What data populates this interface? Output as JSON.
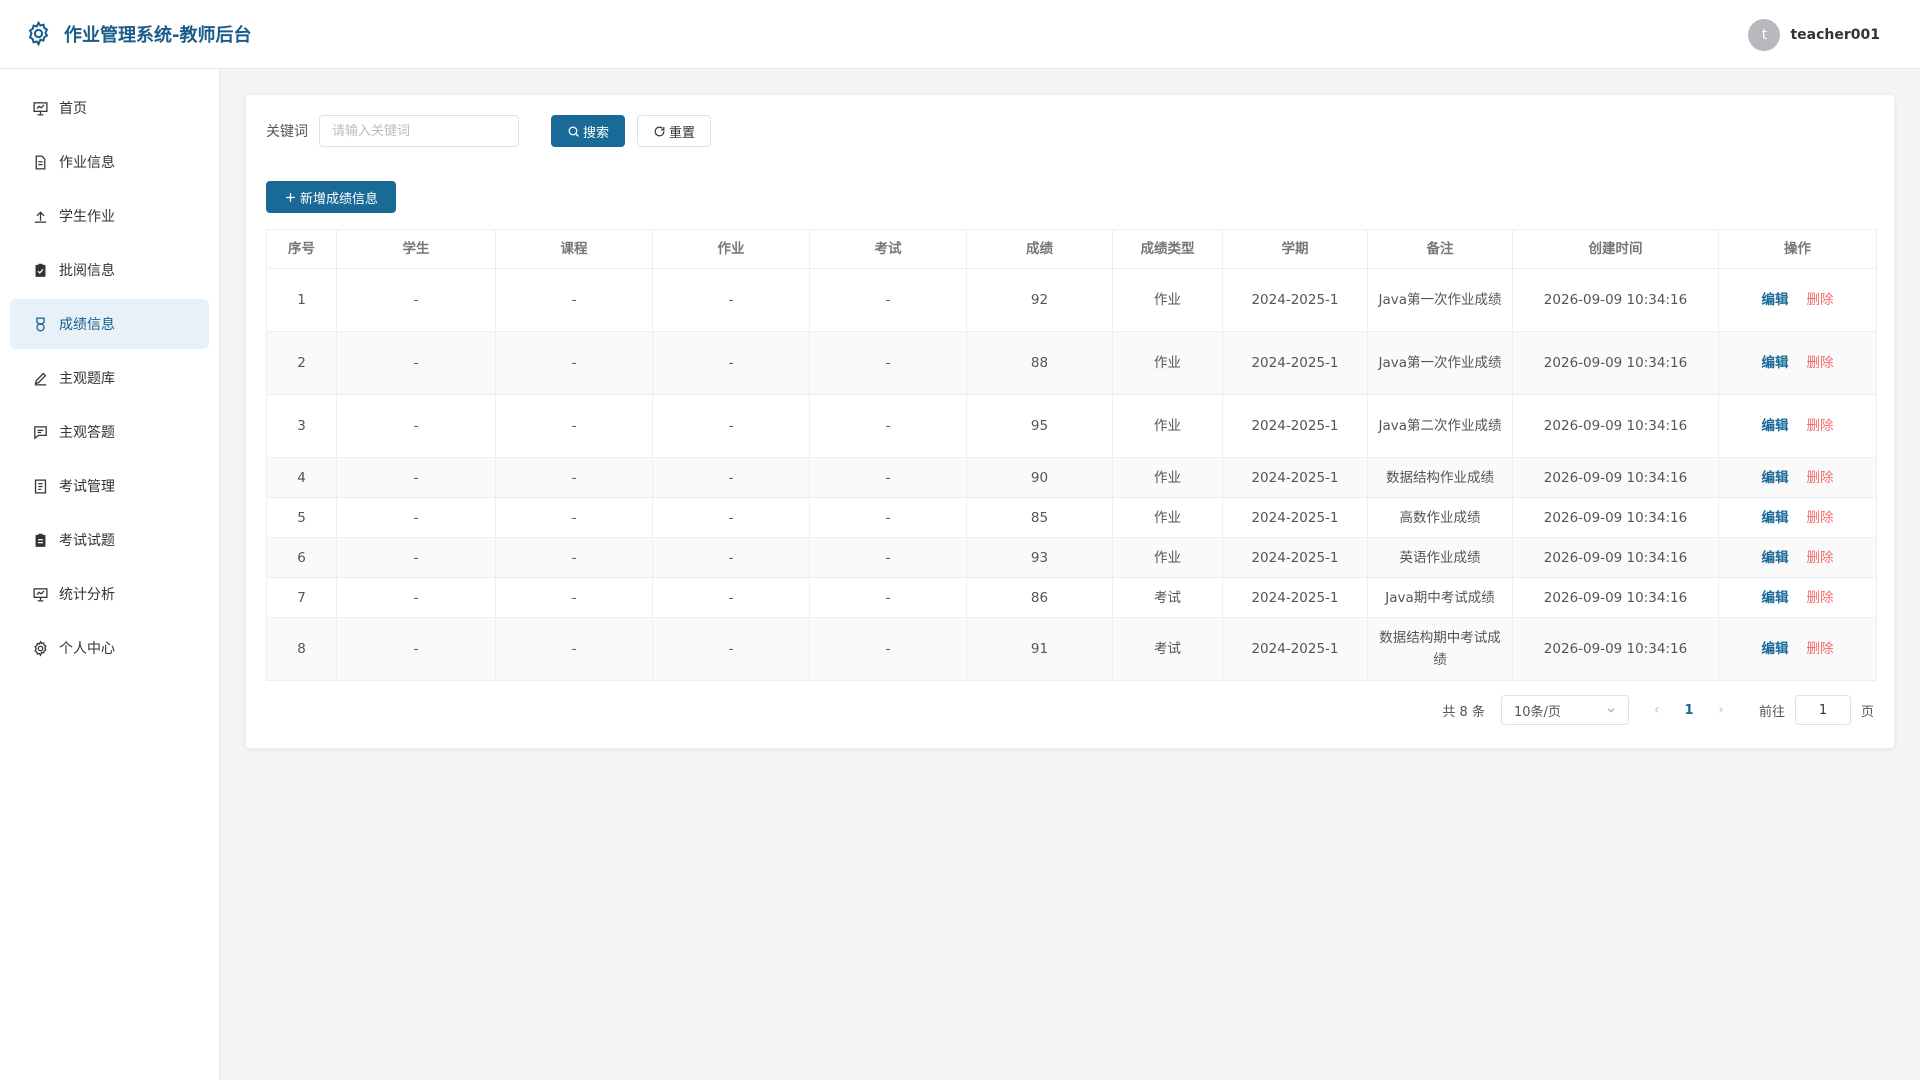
{
  "app": {
    "title": "作业管理系统-教师后台",
    "user": {
      "avatar_letter": "t",
      "name": "teacher001"
    },
    "accent_color": "#1a6a98"
  },
  "sidebar": {
    "items": [
      {
        "label": "首页",
        "icon": "dashboard-icon",
        "active": false
      },
      {
        "label": "作业信息",
        "icon": "document-icon",
        "active": false
      },
      {
        "label": "学生作业",
        "icon": "upload-icon",
        "active": false
      },
      {
        "label": "批阅信息",
        "icon": "clipboard-check-icon",
        "active": false
      },
      {
        "label": "成绩信息",
        "icon": "medal-icon",
        "active": true
      },
      {
        "label": "主观题库",
        "icon": "edit-pen-icon",
        "active": false
      },
      {
        "label": "主观答题",
        "icon": "chat-icon",
        "active": false
      },
      {
        "label": "考试管理",
        "icon": "tickets-icon",
        "active": false
      },
      {
        "label": "考试试题",
        "icon": "notebook-icon",
        "active": false
      },
      {
        "label": "统计分析",
        "icon": "chart-icon",
        "active": false
      },
      {
        "label": "个人中心",
        "icon": "settings-icon",
        "active": false
      }
    ]
  },
  "search": {
    "label": "关键词",
    "placeholder": "请输入关键词",
    "value": "",
    "search_button": "搜索",
    "reset_button": "重置"
  },
  "toolbar": {
    "add_button": "新增成绩信息"
  },
  "table": {
    "headers": [
      "序号",
      "学生",
      "课程",
      "作业",
      "考试",
      "成绩",
      "成绩类型",
      "学期",
      "备注",
      "创建时间",
      "操作"
    ],
    "edit_label": "编辑",
    "delete_label": "删除",
    "rows": [
      {
        "index": "1",
        "student": "-",
        "course": "-",
        "homework": "-",
        "exam": "-",
        "score": "92",
        "type": "作业",
        "term": "2024-2025-1",
        "note": "Java第一次作业成绩",
        "created": "2026-09-09 10:34:16"
      },
      {
        "index": "2",
        "student": "-",
        "course": "-",
        "homework": "-",
        "exam": "-",
        "score": "88",
        "type": "作业",
        "term": "2024-2025-1",
        "note": "Java第一次作业成绩",
        "created": "2026-09-09 10:34:16"
      },
      {
        "index": "3",
        "student": "-",
        "course": "-",
        "homework": "-",
        "exam": "-",
        "score": "95",
        "type": "作业",
        "term": "2024-2025-1",
        "note": "Java第二次作业成绩",
        "created": "2026-09-09 10:34:16"
      },
      {
        "index": "4",
        "student": "-",
        "course": "-",
        "homework": "-",
        "exam": "-",
        "score": "90",
        "type": "作业",
        "term": "2024-2025-1",
        "note": "数据结构作业成绩",
        "created": "2026-09-09 10:34:16"
      },
      {
        "index": "5",
        "student": "-",
        "course": "-",
        "homework": "-",
        "exam": "-",
        "score": "85",
        "type": "作业",
        "term": "2024-2025-1",
        "note": "高数作业成绩",
        "created": "2026-09-09 10:34:16"
      },
      {
        "index": "6",
        "student": "-",
        "course": "-",
        "homework": "-",
        "exam": "-",
        "score": "93",
        "type": "作业",
        "term": "2024-2025-1",
        "note": "英语作业成绩",
        "created": "2026-09-09 10:34:16"
      },
      {
        "index": "7",
        "student": "-",
        "course": "-",
        "homework": "-",
        "exam": "-",
        "score": "86",
        "type": "考试",
        "term": "2024-2025-1",
        "note": "Java期中考试成绩",
        "created": "2026-09-09 10:34:16"
      },
      {
        "index": "8",
        "student": "-",
        "course": "-",
        "homework": "-",
        "exam": "-",
        "score": "91",
        "type": "考试",
        "term": "2024-2025-1",
        "note": "数据结构期中考试成绩",
        "created": "2026-09-09 10:34:16"
      }
    ]
  },
  "pagination": {
    "total_text": "共 8 条",
    "page_size": "10条/页",
    "current_page": "1",
    "goto_label": "前往",
    "goto_value": "1",
    "goto_suffix": "页"
  }
}
